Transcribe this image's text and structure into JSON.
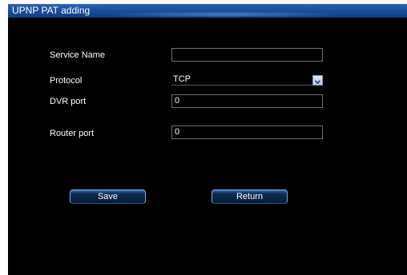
{
  "window": {
    "title": "UPNP PAT adding"
  },
  "form": {
    "service_name": {
      "label": "Service Name",
      "value": ""
    },
    "protocol": {
      "label": "Protocol",
      "value": "TCP"
    },
    "dvr_port": {
      "label": "DVR port",
      "value": "0"
    },
    "router_port": {
      "label": "Router port",
      "value": "0"
    }
  },
  "buttons": {
    "save": "Save",
    "return": "Return"
  },
  "icons": {
    "dropdown": "chevron-down-icon"
  },
  "colors": {
    "background": "#000000",
    "titlebar": "#1a4f9e",
    "text": "#ffffff",
    "field_border": "#6e6e6e",
    "button_border": "#7fa8d8"
  }
}
